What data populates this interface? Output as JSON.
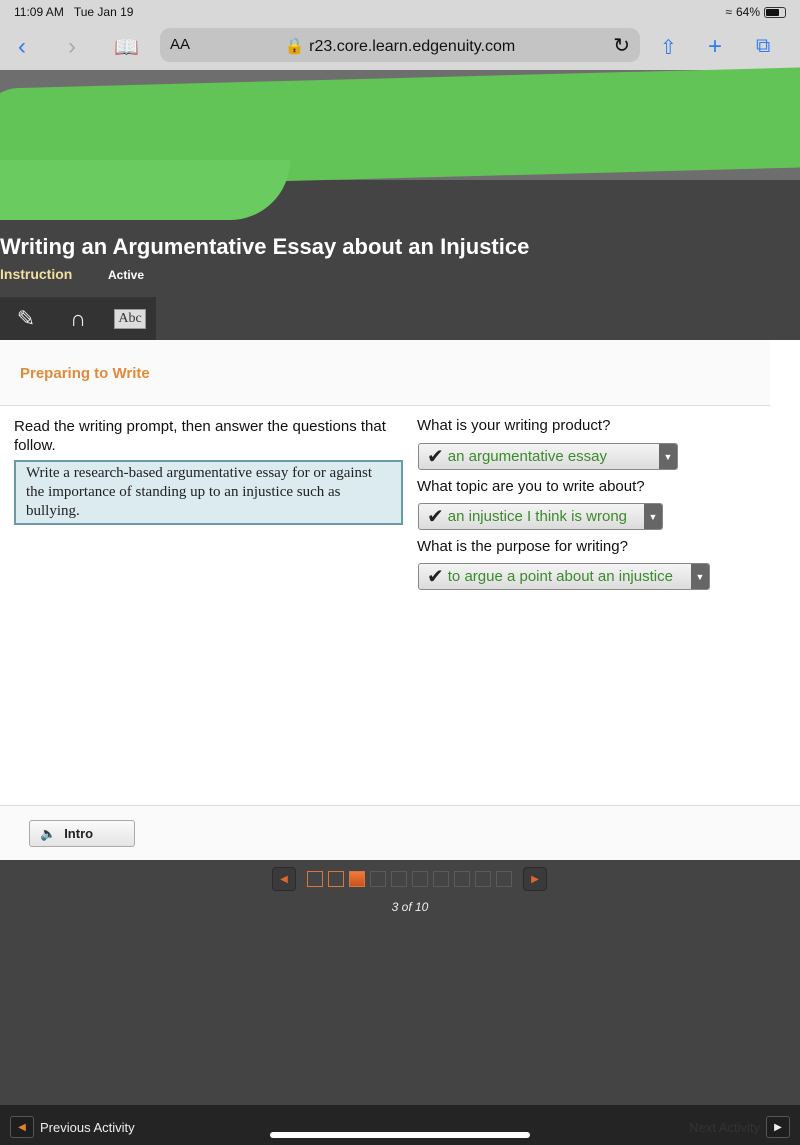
{
  "status": {
    "time": "11:09 AM",
    "date": "Tue Jan 19",
    "battery": "64%"
  },
  "browser": {
    "text_size": "AA",
    "url": "r23.core.learn.edgenuity.com"
  },
  "colors": {
    "accent": "#e08b3a",
    "correct": "#3c8a2e",
    "redaction": "#62c456"
  },
  "lesson": {
    "title": "Writing an Argumentative Essay about an Injustice",
    "tab": "Instruction",
    "state": "Active",
    "tools": [
      "pencil-icon",
      "headphones-icon",
      "dictionary-icon"
    ],
    "dictionary_glyph": "Abc"
  },
  "section": {
    "title": "Preparing to Write"
  },
  "prompt": {
    "intro": "Read the writing prompt, then answer the questions that follow.",
    "text": "Write a research-based argumentative essay for or against the importance of standing up to an injustice such as bullying."
  },
  "questions": [
    {
      "label": "What is your writing product?",
      "answer": "an argumentative essay"
    },
    {
      "label": "What topic are you to write about?",
      "answer": "an injustice I think is wrong"
    },
    {
      "label": "What is the purpose for writing?",
      "answer": "to argue a point about an injustice"
    }
  ],
  "intro_button": "Intro",
  "pager": {
    "current": 3,
    "total": 10,
    "label": "3 of 10"
  },
  "nav": {
    "previous": "Previous Activity",
    "next": "Next Activity"
  }
}
